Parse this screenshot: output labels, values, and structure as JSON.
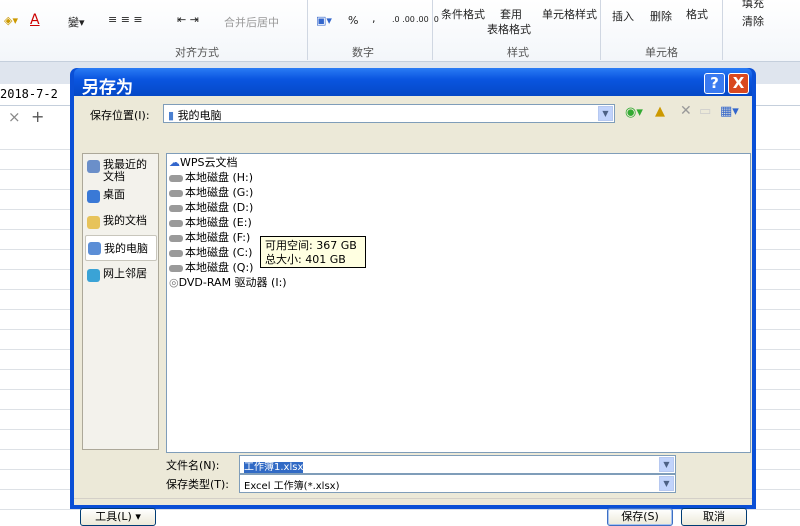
{
  "ribbon": {
    "font_buttons": [
      "A"
    ],
    "merge_center": "合并后居中",
    "percent": "%",
    "comma": ",",
    "inc_decimal": ".0 .00",
    "dec_decimal": ".00 .0",
    "conditional_format": "条件格式",
    "table_format_1": "套用",
    "table_format_2": "表格格式",
    "cell_style": "单元格样式",
    "insert": "插入",
    "delete": "删除",
    "format": "格式",
    "fill": "填充",
    "clear": "清除",
    "groups": {
      "alignment": "对齐方式",
      "number": "数字",
      "styles": "样式",
      "cells": "单元格"
    }
  },
  "formula_bar": {
    "value": "2018-7-2",
    "cancel": "×",
    "add": "+"
  },
  "dialog": {
    "title": "另存为",
    "help": "?",
    "close": "X",
    "save_in_label": "保存位置(I):",
    "save_in_value": "我的电脑",
    "places": [
      {
        "label": "我最近的文档",
        "color": "#6b8fc9"
      },
      {
        "label": "桌面",
        "color": "#3a79d6"
      },
      {
        "label": "我的文档",
        "color": "#e7c35a"
      },
      {
        "label": "我的电脑",
        "color": "#5b8ed6"
      },
      {
        "label": "网上邻居",
        "color": "#3aa3d6"
      }
    ],
    "files": [
      "WPS云文档",
      "本地磁盘 (H:)",
      "本地磁盘 (G:)",
      "本地磁盘 (D:)",
      "本地磁盘 (E:)",
      "本地磁盘 (F:)",
      "本地磁盘 (C:)",
      "本地磁盘 (Q:)",
      "DVD-RAM 驱动器 (I:)"
    ],
    "tooltip": {
      "free": "可用空间: 367 GB",
      "total": "总大小: 401 GB"
    },
    "filename_label": "文件名(N):",
    "filename_value": "工作簿1.xlsx",
    "filetype_label": "保存类型(T):",
    "filetype_value": "Excel 工作簿(*.xlsx)",
    "tools_button": "工具(L)",
    "save_button": "保存(S)",
    "cancel_button": "取消"
  }
}
